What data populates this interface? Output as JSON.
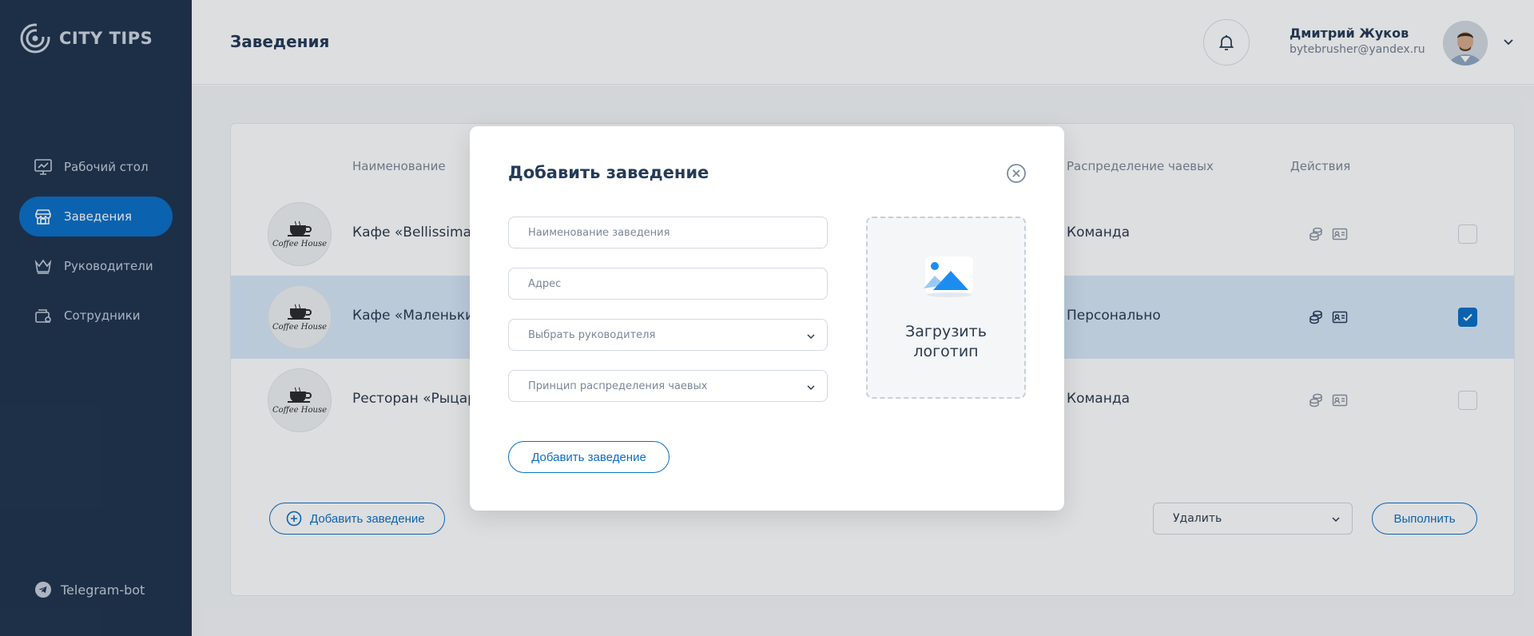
{
  "brand": {
    "name": "CITY TIPS"
  },
  "sidebar": {
    "items": [
      {
        "label": "Рабочий стол",
        "icon": "monitor-chart-icon",
        "active": false
      },
      {
        "label": "Заведения",
        "icon": "shop-icon",
        "active": true
      },
      {
        "label": "Руководители",
        "icon": "crown-icon",
        "active": false
      },
      {
        "label": "Сотрудники",
        "icon": "wallet-user-icon",
        "active": false
      }
    ],
    "telegram_label": "Telegram-bot"
  },
  "header": {
    "title": "Заведения",
    "user_name": "Дмитрий Жуков",
    "user_email": "bytebrusher@yandex.ru"
  },
  "table": {
    "columns": {
      "name": "Наименование",
      "tips": "Распределение чаевых",
      "actions": "Действия"
    },
    "rows": [
      {
        "logo_text": "Coffee House",
        "name": "Кафе «Bellissima»",
        "tips": "Команда",
        "checked": false
      },
      {
        "logo_text": "Coffee House",
        "name": "Кафе «Маленький",
        "tips": "Персонально",
        "checked": true
      },
      {
        "logo_text": "Coffee House",
        "name": "Ресторан «Рыцаро",
        "tips": "Команда",
        "checked": false
      }
    ],
    "add_button": "Добавить заведение",
    "bulk_action_value": "Удалить",
    "execute_button": "Выполнить"
  },
  "modal": {
    "title": "Добавить заведение",
    "name_placeholder": "Наименование заведения",
    "address_placeholder": "Адрес",
    "manager_placeholder": "Выбрать руководителя",
    "tips_placeholder": "Принцип распределения чаевых",
    "upload_line1": "Загрузить",
    "upload_line2": "логотип",
    "submit": "Добавить заведение"
  },
  "colors": {
    "sidebar": "#20344f",
    "accent": "#0b6fc7",
    "selected_row": "#d7e8f8"
  }
}
